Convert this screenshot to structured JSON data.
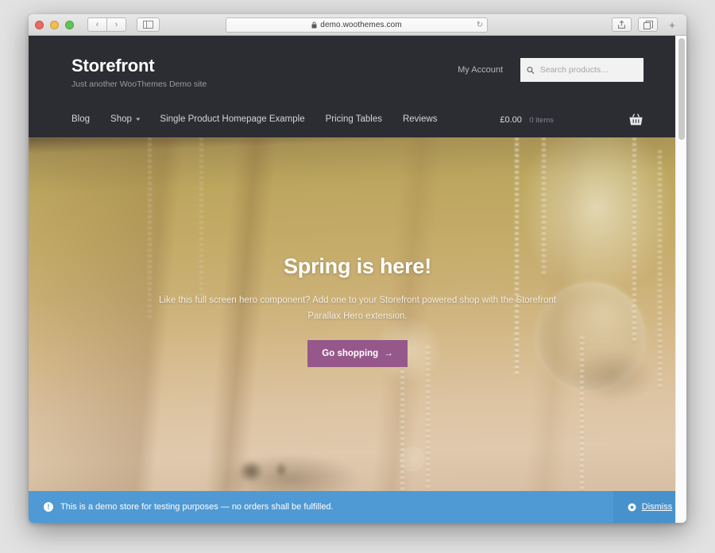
{
  "browser": {
    "window_controls": [
      {
        "name": "close",
        "color": "#ec6a5e"
      },
      {
        "name": "minimize",
        "color": "#f4be4f"
      },
      {
        "name": "maximize",
        "color": "#61c554"
      }
    ],
    "back_label": "‹",
    "forward_label": "›",
    "sidebar_label": "▥",
    "url": "demo.woothemes.com",
    "lock_glyph": "🔒",
    "reload_glyph": "↻",
    "share_glyph": "⇪",
    "tabs_glyph": "❐",
    "newtab_glyph": "+"
  },
  "site": {
    "title": "Storefront",
    "tagline": "Just another WooThemes Demo site",
    "my_account": "My Account",
    "search": {
      "placeholder": "Search products…",
      "value": "",
      "icon": "search-icon"
    },
    "nav": [
      {
        "label": "Blog",
        "has_dropdown": false
      },
      {
        "label": "Shop",
        "has_dropdown": true
      },
      {
        "label": "Single Product Homepage Example",
        "has_dropdown": false
      },
      {
        "label": "Pricing Tables",
        "has_dropdown": false
      },
      {
        "label": "Reviews",
        "has_dropdown": false
      }
    ],
    "nav_chevron": "▾",
    "cart": {
      "amount": "£0.00",
      "count": "0 items",
      "icon": "shopping-basket-icon"
    }
  },
  "hero": {
    "title": "Spring is here!",
    "description": "Like this full screen hero component? Add one to your Storefront powered shop with the Storefront Parallax Hero extension.",
    "button_label": "Go shopping",
    "button_arrow": "→",
    "button_color": "#96588a"
  },
  "notice": {
    "icon": "info-icon",
    "icon_glyph": "!",
    "message": "This is a demo store for testing purposes — no orders shall be fulfilled.",
    "dismiss_label": "Dismiss",
    "dismiss_glyph": "◉",
    "background_color": "#4f9ad4"
  },
  "colors": {
    "header_bg": "#2c2d33",
    "accent": "#96588a",
    "notice": "#4f9ad4"
  }
}
